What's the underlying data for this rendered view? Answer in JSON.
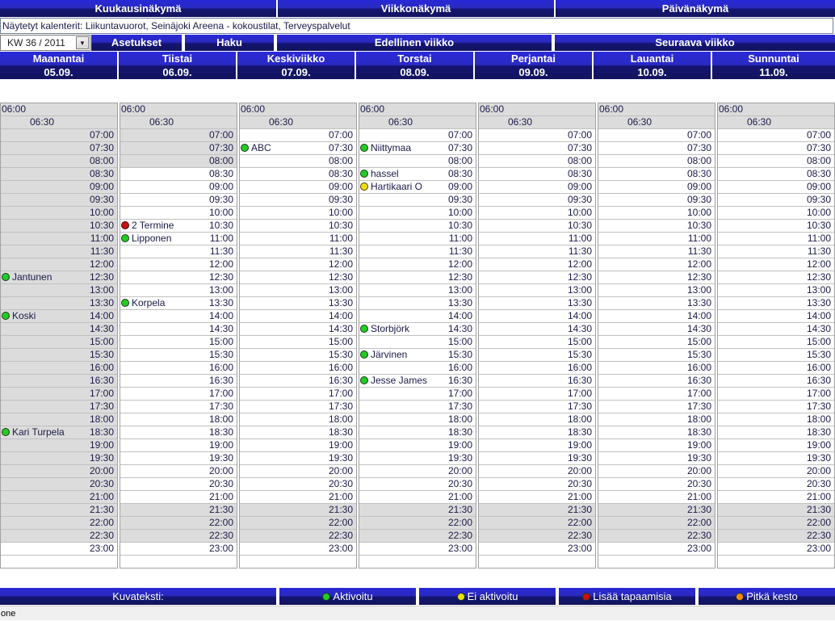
{
  "nav": {
    "month_view": "Kuukausinäkymä",
    "week_view": "Viikkonäkymä",
    "day_view": "Päivänäkymä"
  },
  "shown_calendars": "Näytetyt kalenterit: Liikuntavuorot, Seinäjoki Areena - kokoustilat, Terveyspalvelut",
  "toolbar": {
    "week_select": "KW 36 / 2011",
    "settings": "Asetukset",
    "search": "Haku",
    "prev_week": "Edellinen viikko",
    "next_week": "Seuraava viikko"
  },
  "days": [
    {
      "name": "Maanantai",
      "date": "05.09."
    },
    {
      "name": "Tiistai",
      "date": "06.09."
    },
    {
      "name": "Keskiviikko",
      "date": "07.09."
    },
    {
      "name": "Torstai",
      "date": "08.09."
    },
    {
      "name": "Perjantai",
      "date": "09.09."
    },
    {
      "name": "Lauantai",
      "date": "10.09."
    },
    {
      "name": "Sunnuntai",
      "date": "11.09."
    }
  ],
  "times": [
    "06:00",
    "06:30",
    "07:00",
    "07:30",
    "08:00",
    "08:30",
    "09:00",
    "09:30",
    "10:00",
    "10:30",
    "11:00",
    "11:30",
    "12:00",
    "12:30",
    "13:00",
    "13:30",
    "14:00",
    "14:30",
    "15:00",
    "15:30",
    "16:00",
    "16:30",
    "17:00",
    "17:30",
    "18:00",
    "18:30",
    "19:00",
    "19:30",
    "20:00",
    "20:30",
    "21:00",
    "21:30",
    "22:00",
    "22:30",
    "23:00"
  ],
  "shaded_slots": [
    [
      "06:00",
      "06:30",
      "07:00",
      "07:30",
      "08:00",
      "08:30",
      "09:00",
      "09:30",
      "10:00",
      "10:30",
      "11:00",
      "11:30",
      "12:00",
      "12:30",
      "13:00",
      "13:30",
      "14:00",
      "14:30",
      "15:00",
      "15:30",
      "16:00",
      "16:30",
      "17:00",
      "17:30",
      "18:00",
      "18:30",
      "19:00",
      "19:30",
      "20:00",
      "20:30",
      "21:00",
      "21:30",
      "22:00",
      "22:30"
    ],
    [
      "06:00",
      "06:30",
      "07:00",
      "07:30",
      "08:00",
      "21:30",
      "22:00",
      "22:30"
    ],
    [
      "06:00",
      "06:30",
      "21:30",
      "22:00",
      "22:30"
    ],
    [
      "06:00",
      "06:30",
      "21:30",
      "22:00",
      "22:30"
    ],
    [
      "06:00",
      "06:30",
      "21:30",
      "22:00",
      "22:30"
    ],
    [
      "06:00",
      "06:30",
      "21:30",
      "22:00",
      "22:30"
    ],
    [
      "06:00",
      "06:30",
      "21:30",
      "22:00",
      "22:30"
    ]
  ],
  "events": [
    {
      "day": 0,
      "time": "12:30",
      "title": "Jantunen",
      "status": "active"
    },
    {
      "day": 0,
      "time": "14:00",
      "title": "Koski",
      "status": "active"
    },
    {
      "day": 0,
      "time": "18:30",
      "title": "Kari Turpela",
      "status": "active"
    },
    {
      "day": 1,
      "time": "10:30",
      "title": "2 Termine",
      "status": "multiple"
    },
    {
      "day": 1,
      "time": "11:00",
      "title": "Lipponen",
      "status": "active"
    },
    {
      "day": 1,
      "time": "13:30",
      "title": "Korpela",
      "status": "active"
    },
    {
      "day": 2,
      "time": "07:30",
      "title": "ABC",
      "status": "active"
    },
    {
      "day": 3,
      "time": "07:30",
      "title": "Niittymaa",
      "status": "active"
    },
    {
      "day": 3,
      "time": "08:30",
      "title": "hassel",
      "status": "active"
    },
    {
      "day": 3,
      "time": "09:00",
      "title": "Hartikaari O",
      "status": "inactive"
    },
    {
      "day": 3,
      "time": "14:30",
      "title": "Storbjörk",
      "status": "active"
    },
    {
      "day": 3,
      "time": "15:30",
      "title": "Järvinen",
      "status": "active"
    },
    {
      "day": 3,
      "time": "16:30",
      "title": "Jesse James",
      "status": "active"
    }
  ],
  "legend": {
    "caption": "Kuvateksti:",
    "active": "Aktivoitu",
    "inactive": "Ei aktivoitu",
    "multiple": "Lisää tapaamisia",
    "long": "Pitkä kesto"
  },
  "status_colors": {
    "active": "#22cc22",
    "inactive": "#f0e000",
    "multiple": "#cc1010",
    "long": "#ff8a10"
  },
  "statusbar": "one"
}
